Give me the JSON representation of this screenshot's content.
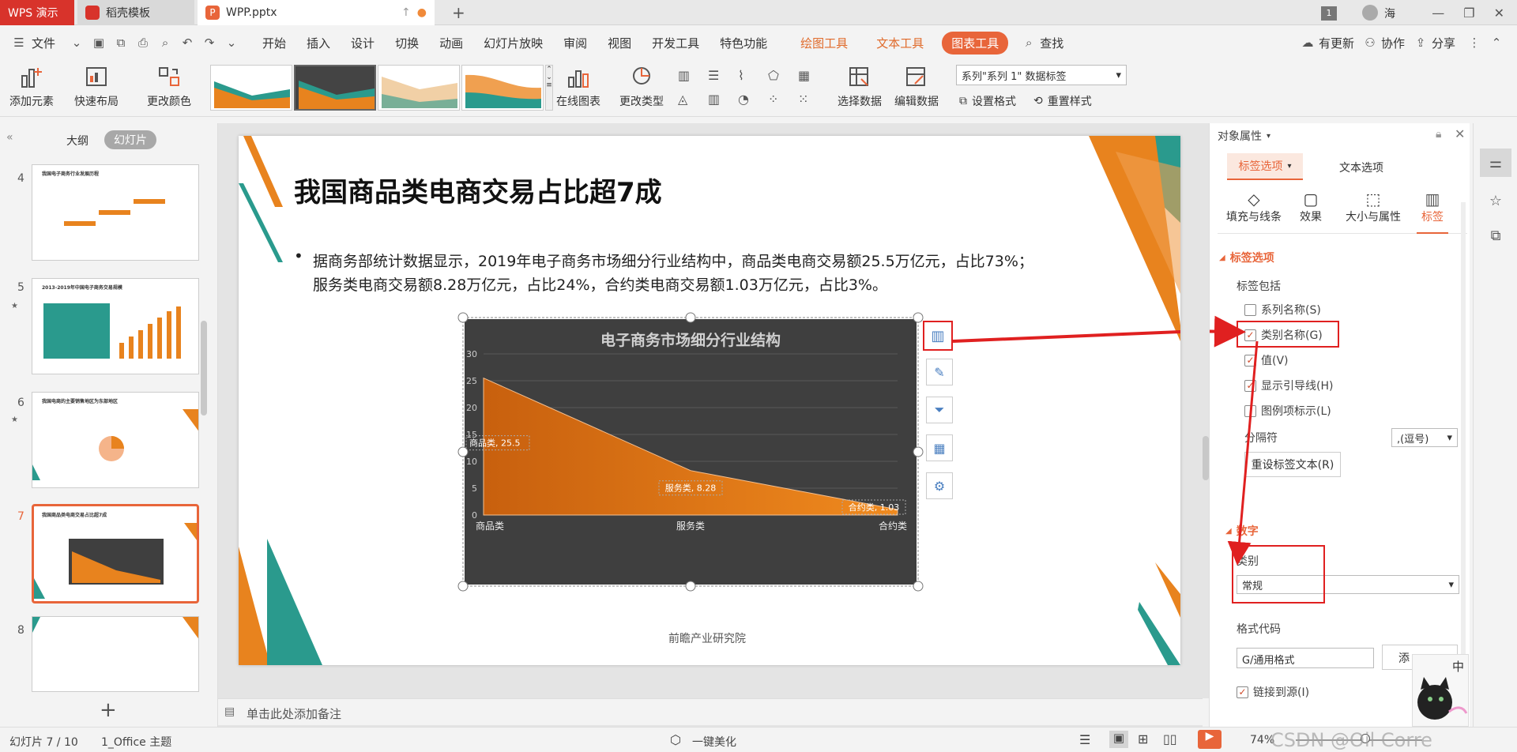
{
  "titlebar": {
    "wps_tab": "WPS 演示",
    "docer_tab": "稻壳模板",
    "file_tab": "WPP.pptx",
    "badge_count": "1",
    "user_name": "海"
  },
  "menubar": {
    "file": "文件",
    "items": [
      "开始",
      "插入",
      "设计",
      "切换",
      "动画",
      "幻灯片放映",
      "审阅",
      "视图",
      "开发工具",
      "特色功能"
    ],
    "context_items": [
      "绘图工具",
      "文本工具"
    ],
    "active_item": "图表工具",
    "search": "查找",
    "right": [
      "有更新",
      "协作",
      "分享"
    ]
  },
  "ribbon": {
    "add_element": "添加元素",
    "quick_layout": "快速布局",
    "change_color": "更改颜色",
    "online_chart": "在线图表",
    "change_type": "更改类型",
    "select_data": "选择数据",
    "edit_data": "编辑数据",
    "series_dropdown": "系列\"系列 1\" 数据标签",
    "set_format": "设置格式",
    "reset_style": "重置样式"
  },
  "leftpanel": {
    "outline_tab": "大纲",
    "slides_tab": "幻灯片",
    "slides": [
      {
        "num": "4",
        "title": "我国电子商务行业发展历程"
      },
      {
        "num": "5",
        "title": "2013-2019年中国电子商务交易规模"
      },
      {
        "num": "6",
        "title": "我国电商的主要销售地区为东部地区"
      },
      {
        "num": "7",
        "title": "我国商品类电商交易占比超7成"
      },
      {
        "num": "8",
        "title": ""
      }
    ],
    "add_slide": "+"
  },
  "slide": {
    "title": "我国商品类电商交易占比超7成",
    "bullet_line1": "据商务部统计数据显示，2019年电子商务市场细分行业结构中，商品类电商交易额25.5万亿元，占比73%；",
    "bullet_line2": "服务类电商交易额8.28万亿元，占比24%，合约类电商交易额1.03万亿元，占比3%。",
    "source": "前瞻产业研究院"
  },
  "chart_data": {
    "type": "area",
    "title": "电子商务市场细分行业结构",
    "categories": [
      "商品类",
      "服务类",
      "合约类"
    ],
    "values": [
      25.5,
      8.28,
      1.03
    ],
    "data_labels": [
      "商品类, 25.5",
      "服务类, 8.28",
      "合约类, 1.03"
    ],
    "yticks": [
      "0",
      "5",
      "10",
      "15",
      "20",
      "25",
      "30"
    ],
    "ylim": [
      0,
      30
    ],
    "grid": true,
    "colors": {
      "background": "#3f3f3f",
      "fill": "#e8831e"
    }
  },
  "notes": {
    "placeholder": "单击此处添加备注"
  },
  "rightpanel": {
    "header": "对象属性",
    "tab_label_options": "标签选项",
    "tab_text_options": "文本选项",
    "subtabs": [
      "填充与线条",
      "效果",
      "大小与属性",
      "标签"
    ],
    "section_label_options": "标签选项",
    "label_contains": "标签包括",
    "checks": [
      {
        "label": "系列名称(S)",
        "checked": false
      },
      {
        "label": "类别名称(G)",
        "checked": true
      },
      {
        "label": "值(V)",
        "checked": true
      },
      {
        "label": "显示引导线(H)",
        "checked": true
      },
      {
        "label": "图例项标示(L)",
        "checked": false
      }
    ],
    "separator_label": "分隔符",
    "separator_value": ",(逗号)",
    "reset_label_text": "重设标签文本(R)",
    "section_number": "数字",
    "category_label": "类别",
    "category_value": "常规",
    "format_code_label": "格式代码",
    "format_code_value": "G/通用格式",
    "add_btn": "添",
    "link_to_source": "链接到源(I)",
    "ime_char": "中"
  },
  "statusbar": {
    "slide_info": "幻灯片 7 / 10",
    "theme": "1_Office 主题",
    "beautify": "一键美化",
    "zoom": "74%",
    "watermark": "CSDN @Oil Corre"
  }
}
